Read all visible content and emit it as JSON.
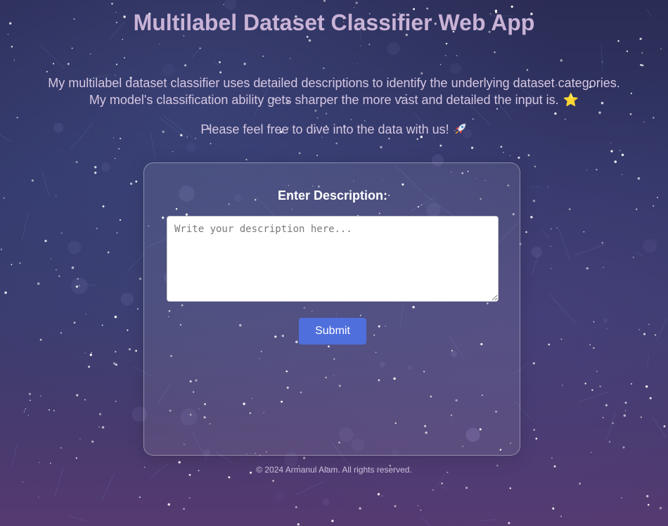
{
  "header": {
    "title": "Multilabel Dataset Classifier Web App"
  },
  "intro": {
    "line1": "My multilabel dataset classifier uses detailed descriptions to identify the underlying dataset categories.",
    "line2": "My model's classification ability gets sharper the more vast and detailed the input is.",
    "line2_emoji": "⭐",
    "cta": "Please feel free to dive into the data with us!",
    "cta_icon": "rocket-icon"
  },
  "form": {
    "label": "Enter Description:",
    "textarea_value": "",
    "textarea_placeholder": "Write your description here...",
    "submit_label": "Submit",
    "submit_color": "#4f6fdc"
  },
  "footer": {
    "copyright": "© 2024 Armanul Alam. All rights reserved."
  },
  "colors": {
    "title": "#c9b3d6",
    "background_top": "#2b2c55",
    "background_bottom": "#553a70"
  }
}
